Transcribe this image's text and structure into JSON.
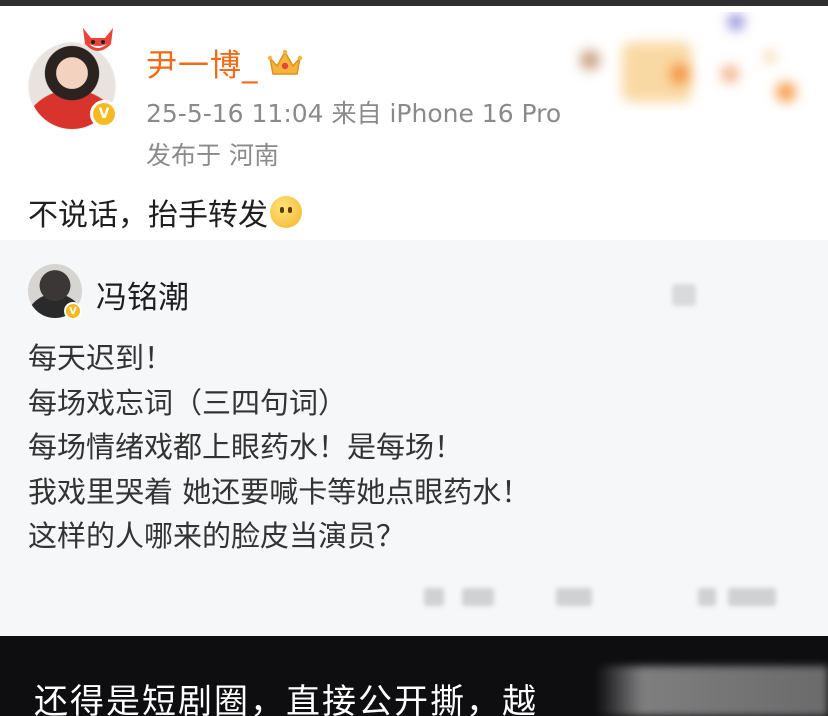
{
  "post": {
    "username": "尹一博_",
    "time_source": "25-5-16 11:04  来自 iPhone 16 Pro",
    "location": "发布于 河南",
    "text": "不说话，抬手转发"
  },
  "repost": {
    "author": "冯铭潮",
    "lines": [
      "每天迟到！",
      "每场戏忘词（三四句词）",
      "每场情绪戏都上眼药水！是每场！",
      "我戏里哭着 她还要喊卡等她点眼药水！",
      "这样的人哪来的脸皮当演员？"
    ]
  },
  "caption": {
    "text": "还得是短剧圈，直接公开撕，越"
  },
  "colors": {
    "username": "#f26a13",
    "meta": "#8a8a8a",
    "repost_bg": "#f6f7f8",
    "caption_bg": "#0e0e10",
    "verified_badge": "#f6b921"
  },
  "icons": {
    "avatar_badge": "verified-v-icon",
    "crown": "crown-icon",
    "emoji": "smile-emoji-icon",
    "fox": "fox-decoration-icon"
  }
}
